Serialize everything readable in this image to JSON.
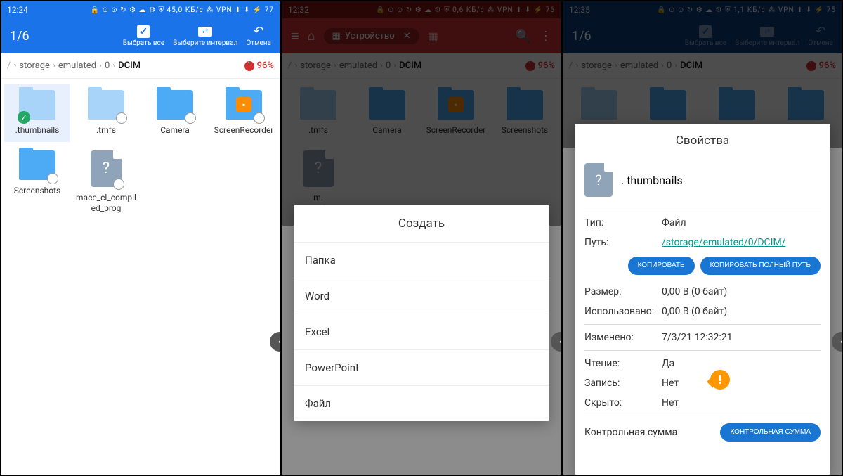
{
  "screen1": {
    "status": {
      "time": "12:24",
      "right": "45,0 КБ/с ⁂ VPN ⬆ ⬇ ⚡ 77"
    },
    "topbar": {
      "count": "1/6",
      "select_all": "Выбрать все",
      "interval": "Выберите интервал",
      "cancel": "Отмена"
    },
    "breadcrumb": {
      "segs": [
        "storage",
        "emulated",
        "0",
        "DCIM"
      ],
      "pct": "96%"
    },
    "files": [
      {
        "name": ".thumbnails",
        "selected": true
      },
      {
        "name": ".tmfs"
      },
      {
        "name": "Camera"
      },
      {
        "name": "ScreenRecorder",
        "app": true
      },
      {
        "name": "Screenshots"
      },
      {
        "name": "mace_cl_compiled_prog",
        "file": true
      }
    ]
  },
  "screen2": {
    "status": {
      "time": "12:32",
      "right": "0,6 КБ/с ⁂ VPN ⬆ ⬇ ⚡ 76"
    },
    "home": "Устройство",
    "breadcrumb": {
      "segs": [
        "storage",
        "emulated",
        "0",
        "DCIM"
      ],
      "pct": "96%"
    },
    "files": [
      {
        "name": ".tmfs"
      },
      {
        "name": "Camera"
      },
      {
        "name": "ScreenRecorder",
        "app": true
      },
      {
        "name": "Screenshots"
      }
    ],
    "dialog": {
      "title": "Создать",
      "items": [
        "Папка",
        "Word",
        "Excel",
        "PowerPoint",
        "Файл"
      ]
    }
  },
  "screen3": {
    "status": {
      "time": "12:35",
      "right": "1,1 КБ/с ⁂ VPN ⬆ ⬇ ⚡ 75"
    },
    "topbar": {
      "count": "1/6",
      "select_all": "Выбрать все",
      "interval": "Выберите интервал",
      "cancel": "Отмена"
    },
    "breadcrumb": {
      "segs": [
        "storage",
        "emulated",
        "0",
        "DCIM"
      ],
      "pct": "96%"
    },
    "dialog": {
      "title": "Свойства",
      "filename": ". thumbnails",
      "type_k": "Тип:",
      "type_v": "Файл",
      "path_k": "Путь:",
      "path_v": "/storage/emulated/0/DCIM/",
      "copy": "КОПИРОВАТЬ",
      "copy_full": "КОПИРОВАТЬ ПОЛНЫЙ ПУТЬ",
      "size_k": "Размер:",
      "size_v": "0,00 B (0 байт)",
      "used_k": "Использовано:",
      "used_v": "0,00 B (0 байт)",
      "mod_k": "Изменено:",
      "mod_v": "7/3/21 12:32:21",
      "read_k": "Чтение:",
      "read_v": "Да",
      "write_k": "Запись:",
      "write_v": "Нет",
      "hidden_k": "Скрыто:",
      "hidden_v": "Нет",
      "checksum_k": "Контрольная сумма",
      "checksum_btn": "КОНТРОЛЬНАЯ СУММА"
    }
  }
}
